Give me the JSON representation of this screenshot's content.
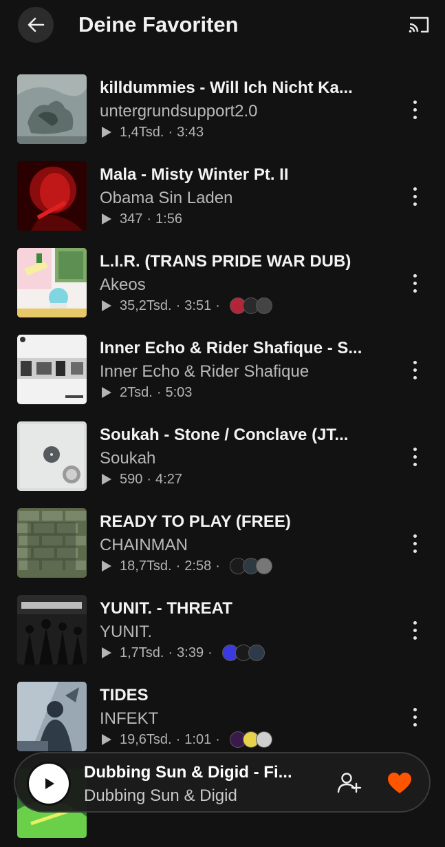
{
  "header": {
    "title": "Deine Favoriten"
  },
  "tracks": [
    {
      "title": "killdummies - Will Ich Nicht Ka...",
      "artist": "untergrundsupport2.0",
      "plays": "1,4Tsd.",
      "duration": "3:43",
      "avatars": []
    },
    {
      "title": "Mala - Misty Winter Pt. II",
      "artist": "Obama Sin Laden",
      "plays": "347",
      "duration": "1:56",
      "avatars": []
    },
    {
      "title": "L.I.R. (TRANS PRIDE WAR DUB)",
      "artist": "Akeos",
      "plays": "35,2Tsd.",
      "duration": "3:51",
      "avatars": [
        "#b3263a",
        "#2a2a2a",
        "#444444"
      ]
    },
    {
      "title": "Inner Echo & Rider Shafique - S...",
      "artist": "Inner Echo & Rider Shafique",
      "plays": "2Tsd.",
      "duration": "5:03",
      "avatars": []
    },
    {
      "title": "Soukah - Stone / Conclave (JT...",
      "artist": "Soukah",
      "plays": "590",
      "duration": "4:27",
      "avatars": []
    },
    {
      "title": "READY TO PLAY (FREE)",
      "artist": "CHAINMAN",
      "plays": "18,7Tsd.",
      "duration": "2:58",
      "avatars": [
        "#1b1b1b",
        "#2e3a42",
        "#777777"
      ]
    },
    {
      "title": "YUNIT. - THREAT",
      "artist": "YUNIT.",
      "plays": "1,7Tsd.",
      "duration": "3:39",
      "avatars": [
        "#3a3adf",
        "#1a1a1a",
        "#2d3a4a"
      ]
    },
    {
      "title": "TIDES",
      "artist": "INFEKT",
      "plays": "19,6Tsd.",
      "duration": "1:01",
      "avatars": [
        "#3a1a4a",
        "#e8d24a",
        "#cfcfcf"
      ]
    }
  ],
  "now_playing": {
    "title": "Dubbing Sun & Digid - Fi...",
    "artist": "Dubbing Sun & Digid"
  },
  "colors": {
    "accent": "#ff5500",
    "background": "#121212"
  }
}
